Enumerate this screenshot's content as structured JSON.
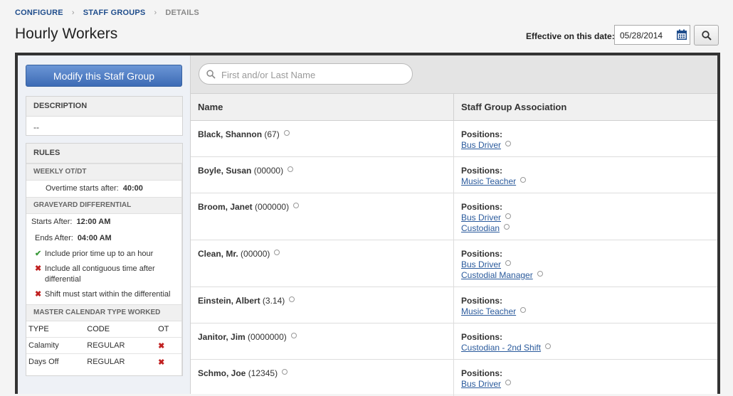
{
  "breadcrumb": {
    "configure": "CONFIGURE",
    "staff_groups": "STAFF GROUPS",
    "details": "DETAILS",
    "sep": "›"
  },
  "page_title": "Hourly Workers",
  "effective": {
    "label": "Effective on this date:",
    "date": "05/28/2014"
  },
  "left": {
    "modify_label": "Modify this Staff Group",
    "description": {
      "header": "DESCRIPTION",
      "value": "--"
    },
    "rules": {
      "header": "RULES",
      "weekly": {
        "header": "WEEKLY OT/DT",
        "label": "Overtime starts after:",
        "value": "40:00"
      },
      "graveyard": {
        "header": "GRAVEYARD DIFFERENTIAL",
        "starts_label": "Starts After:",
        "starts_value": "12:00 AM",
        "ends_label": "Ends After:",
        "ends_value": "04:00 AM",
        "checks": [
          {
            "text": "Include prior time up to an hour",
            "ok": true
          },
          {
            "text": "Include all contiguous time after differential",
            "ok": false
          },
          {
            "text": "Shift must start within the differential",
            "ok": false
          }
        ]
      },
      "master": {
        "header": "MASTER CALENDAR TYPE WORKED",
        "cols": [
          "TYPE",
          "CODE",
          "OT"
        ],
        "rows": [
          {
            "type": "Calamity",
            "code": "REGULAR"
          },
          {
            "type": "Days Off",
            "code": "REGULAR"
          }
        ]
      }
    }
  },
  "search": {
    "placeholder": "First and/or Last Name"
  },
  "grid": {
    "col_name": "Name",
    "col_assoc": "Staff Group Association",
    "positions_label": "Positions:",
    "rows": [
      {
        "name": "Black, Shannon",
        "id": "(67)",
        "positions": [
          "Bus Driver"
        ]
      },
      {
        "name": "Boyle, Susan",
        "id": "(00000)",
        "positions": [
          "Music Teacher"
        ]
      },
      {
        "name": "Broom, Janet",
        "id": "(000000)",
        "positions": [
          "Bus Driver",
          "Custodian"
        ]
      },
      {
        "name": "Clean, Mr.",
        "id": "(00000)",
        "positions": [
          "Bus Driver",
          "Custodial Manager"
        ]
      },
      {
        "name": "Einstein, Albert",
        "id": "(3.14)",
        "positions": [
          "Music Teacher"
        ]
      },
      {
        "name": "Janitor, Jim",
        "id": "(0000000)",
        "positions": [
          "Custodian - 2nd Shift"
        ]
      },
      {
        "name": "Schmo, Joe",
        "id": "(12345)",
        "positions": [
          "Bus Driver"
        ]
      }
    ]
  }
}
